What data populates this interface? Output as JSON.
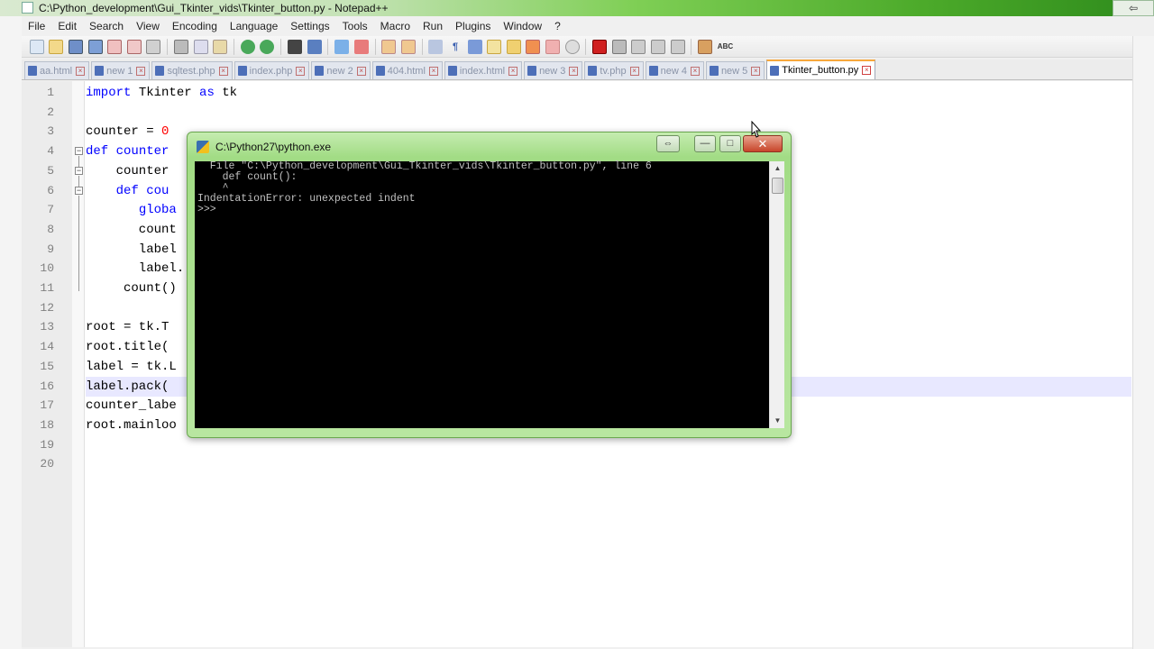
{
  "window": {
    "title": "C:\\Python_development\\Gui_Tkinter_vids\\Tkinter_button.py - Notepad++",
    "restore_glyph": "⇦"
  },
  "menu": [
    "File",
    "Edit",
    "Search",
    "View",
    "Encoding",
    "Language",
    "Settings",
    "Tools",
    "Macro",
    "Run",
    "Plugins",
    "Window",
    "?"
  ],
  "tabs": [
    {
      "label": "aa.html",
      "active": false
    },
    {
      "label": "new 1",
      "active": false
    },
    {
      "label": "sqltest.php",
      "active": false
    },
    {
      "label": "index.php",
      "active": false
    },
    {
      "label": "new 2",
      "active": false
    },
    {
      "label": "404.html",
      "active": false
    },
    {
      "label": "index.html",
      "active": false
    },
    {
      "label": "new 3",
      "active": false
    },
    {
      "label": "tv.php",
      "active": false
    },
    {
      "label": "new 4",
      "active": false
    },
    {
      "label": "new 5",
      "active": false
    },
    {
      "label": "Tkinter_button.py",
      "active": true
    }
  ],
  "editor": {
    "current_line": 16,
    "lines": [
      {
        "n": "1",
        "tokens": [
          {
            "t": "import",
            "c": "kw"
          },
          {
            "t": " Tkinter ",
            "c": ""
          },
          {
            "t": "as",
            "c": "kw"
          },
          {
            "t": " tk",
            "c": ""
          }
        ]
      },
      {
        "n": "2",
        "tokens": []
      },
      {
        "n": "3",
        "tokens": [
          {
            "t": "counter = ",
            "c": ""
          },
          {
            "t": "0",
            "c": "num"
          }
        ]
      },
      {
        "n": "4",
        "tokens": [
          {
            "t": "def",
            "c": "kw"
          },
          {
            "t": " ",
            "c": ""
          },
          {
            "t": "counter",
            "c": "kw"
          }
        ]
      },
      {
        "n": "5",
        "tokens": [
          {
            "t": "    counter",
            "c": ""
          }
        ]
      },
      {
        "n": "6",
        "tokens": [
          {
            "t": "    ",
            "c": ""
          },
          {
            "t": "def",
            "c": "kw"
          },
          {
            "t": " ",
            "c": ""
          },
          {
            "t": "cou",
            "c": "kw"
          }
        ]
      },
      {
        "n": "7",
        "tokens": [
          {
            "t": "       ",
            "c": ""
          },
          {
            "t": "globa",
            "c": "kw"
          }
        ]
      },
      {
        "n": "8",
        "tokens": [
          {
            "t": "       count",
            "c": ""
          }
        ]
      },
      {
        "n": "9",
        "tokens": [
          {
            "t": "       label",
            "c": ""
          }
        ]
      },
      {
        "n": "10",
        "tokens": [
          {
            "t": "       label.",
            "c": ""
          }
        ]
      },
      {
        "n": "11",
        "tokens": [
          {
            "t": "     count()",
            "c": ""
          }
        ]
      },
      {
        "n": "12",
        "tokens": []
      },
      {
        "n": "13",
        "tokens": [
          {
            "t": "root = tk.T",
            "c": ""
          }
        ]
      },
      {
        "n": "14",
        "tokens": [
          {
            "t": "root.title(",
            "c": ""
          }
        ]
      },
      {
        "n": "15",
        "tokens": [
          {
            "t": "label = tk.L",
            "c": ""
          }
        ]
      },
      {
        "n": "16",
        "tokens": [
          {
            "t": "label.pack(",
            "c": ""
          }
        ]
      },
      {
        "n": "17",
        "tokens": [
          {
            "t": "counter_labe",
            "c": ""
          }
        ]
      },
      {
        "n": "18",
        "tokens": [
          {
            "t": "root.mainloo",
            "c": ""
          }
        ]
      },
      {
        "n": "19",
        "tokens": []
      },
      {
        "n": "20",
        "tokens": []
      }
    ]
  },
  "console": {
    "title": "C:\\Python27\\python.exe",
    "minimize_glyph": "—",
    "maximize_glyph": "□",
    "close_glyph": "✕",
    "restore_glyph": "⇔",
    "output": "  File \"C:\\Python_development\\Gui_Tkinter_vids\\Tkinter_button.py\", line 6\n    def count():\n    ^\nIndentationError: unexpected indent\n>>>"
  },
  "colors": {
    "keyword": "#0000ff",
    "number": "#ff0000",
    "current_line": "#e8e8ff",
    "active_tab_accent": "#f7a83c"
  }
}
